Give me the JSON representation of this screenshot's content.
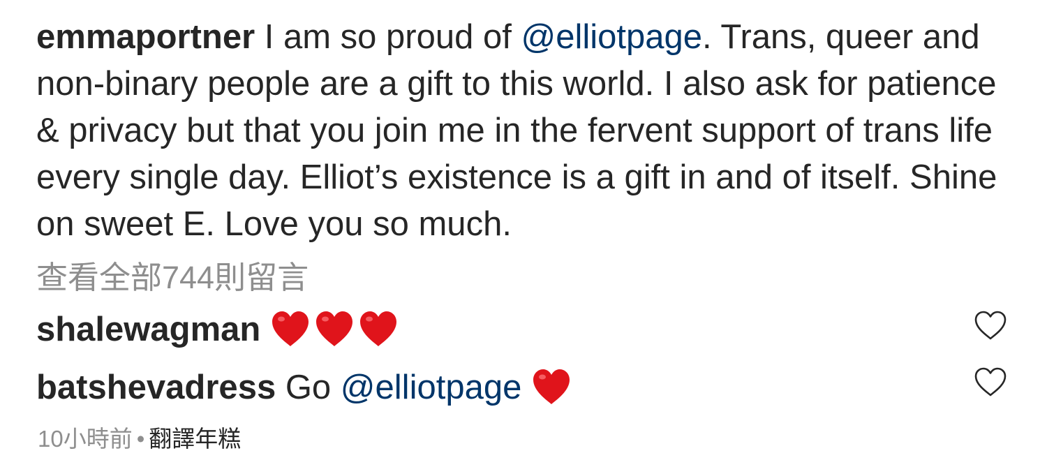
{
  "post": {
    "username": "emmaportner",
    "caption_part1": " I am so proud of ",
    "mention": "@elliotpage",
    "caption_part2": ". Trans, queer and non-binary people are a gift to this world. I also ask for patience & privacy but that you join me in the fervent support of trans life every single day. Elliot’s existence is a gift in and of itself. Shine on sweet E. Love you so much."
  },
  "view_all_comments": "查看全部744則留言",
  "comments": [
    {
      "username": "shalewagman",
      "text": "",
      "mention": "",
      "emoji": [
        "red-heart",
        "red-heart",
        "red-heart"
      ]
    },
    {
      "username": "batshevadress",
      "text": " Go ",
      "mention": "@elliotpage",
      "emoji": [
        "red-heart"
      ]
    }
  ],
  "meta": {
    "time": "10小時前",
    "separator": "•",
    "translate_label": "翻譯年糕"
  },
  "icons": {
    "like": "heart-outline-icon",
    "emoji": "red-heart-emoji"
  },
  "colors": {
    "text": "#262626",
    "mention": "#003569",
    "muted": "#8e8e8e",
    "heart_red": "#e0141b"
  }
}
